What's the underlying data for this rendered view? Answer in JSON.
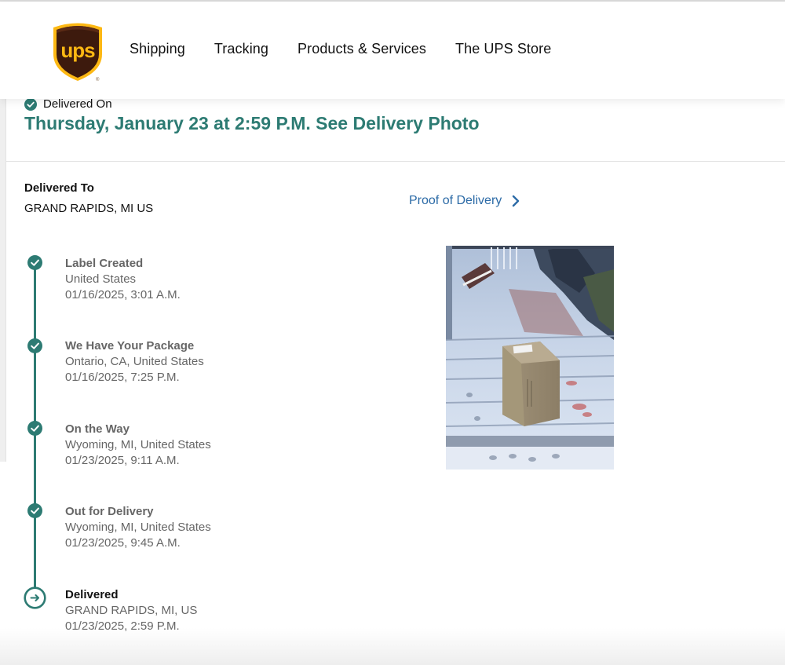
{
  "header": {
    "logo_text": "UPS",
    "nav": [
      "Shipping",
      "Tracking",
      "Products & Services",
      "The UPS Store"
    ]
  },
  "status": {
    "label": "Delivered On",
    "headline": "Thursday, January 23 at 2:59 P.M. See Delivery Photo"
  },
  "delivered_to": {
    "label": "Delivered To",
    "value": "GRAND RAPIDS, MI US"
  },
  "proof_of_delivery": {
    "label": "Proof of Delivery",
    "icon": "chevron-right-icon"
  },
  "timeline": [
    {
      "title": "Label Created",
      "location": "United States",
      "datetime": "01/16/2025, 3:01 A.M.",
      "state": "complete"
    },
    {
      "title": "We Have Your Package",
      "location": "Ontario, CA, United States",
      "datetime": "01/16/2025, 7:25 P.M.",
      "state": "complete"
    },
    {
      "title": "On the Way",
      "location": "Wyoming, MI, United States",
      "datetime": "01/23/2025, 9:11 A.M.",
      "state": "complete"
    },
    {
      "title": "Out for Delivery",
      "location": "Wyoming, MI, United States",
      "datetime": "01/23/2025, 9:45 A.M.",
      "state": "complete"
    },
    {
      "title": "Delivered",
      "location": "GRAND RAPIDS, MI, US",
      "datetime": "01/23/2025, 2:59 P.M.",
      "state": "current"
    }
  ],
  "colors": {
    "accent": "#2d7b73",
    "link": "#2b6aa6",
    "ups_brown": "#3d1a0d",
    "ups_gold": "#fdb813"
  }
}
